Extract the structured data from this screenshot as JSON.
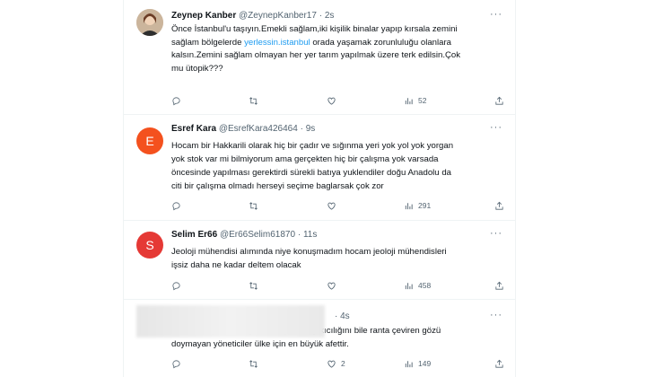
{
  "tweets": [
    {
      "name": "Zeynep Kanber",
      "handle": "@ZeynepKanber17",
      "sep": "·",
      "time": "2s",
      "more": "···",
      "text_lines": [
        "Önce İstanbul'u taşıyın.Emekli sağlam,iki kişilik binalar yapıp kırsala zemini",
        "sağlam bölgelerde ",
        " orada yaşamak zorunluluğu olanlara",
        "kalsın.Zemini sağlam olmayan her yer tarım yapılmak üzere terk edilsin.Çok",
        "mu ütopik???"
      ],
      "link": "yerlessin.istanbul",
      "views": "52"
    },
    {
      "avatar_letter": "E",
      "name": "Esref Kara",
      "handle": "@EsrefKara426464",
      "sep": "·",
      "time": "9s",
      "more": "···",
      "text_lines": [
        "Hocam bir Hakkarili olarak hiç bir çadır ve sığınma yeri yok yol yok yorgan",
        "yok stok var mi bilmiyorum ama gerçekten hiç bir çalışma yok varsada",
        "öncesinde yapılması gerektirdi sürekli batıya yuklendiler doğu Anadolu da",
        "citi bir çalışma olmadı herseyi seçime baglarsak çok zor"
      ],
      "views": "291"
    },
    {
      "avatar_letter": "S",
      "name": "Selim Er66",
      "handle": "@Er66Selim61870",
      "sep": "·",
      "time": "11s",
      "more": "···",
      "text_lines": [
        "Jeoloji mühendisi alımında niye konuşmadım hocam jeoloji mühendisleri",
        "işsiz daha ne kadar deltem olacak"
      ],
      "views": "458"
    },
    {
      "sep": "·",
      "time": "4s",
      "more": "···",
      "text_lines": [
        "Kentleri kupon arsa gören, depremin yıkıcılığını bile ranta çeviren gözü",
        "doymayan yöneticiler ülke için en büyük afettir."
      ],
      "likes": "2",
      "views": "149"
    }
  ],
  "icons": [
    "reply-icon",
    "retweet-icon",
    "like-icon",
    "views-icon",
    "share-icon"
  ],
  "colors": {
    "link": "#1d9bf0",
    "secondary": "#536471",
    "avatar_e": "#f4511e",
    "avatar_s": "#e53935"
  }
}
